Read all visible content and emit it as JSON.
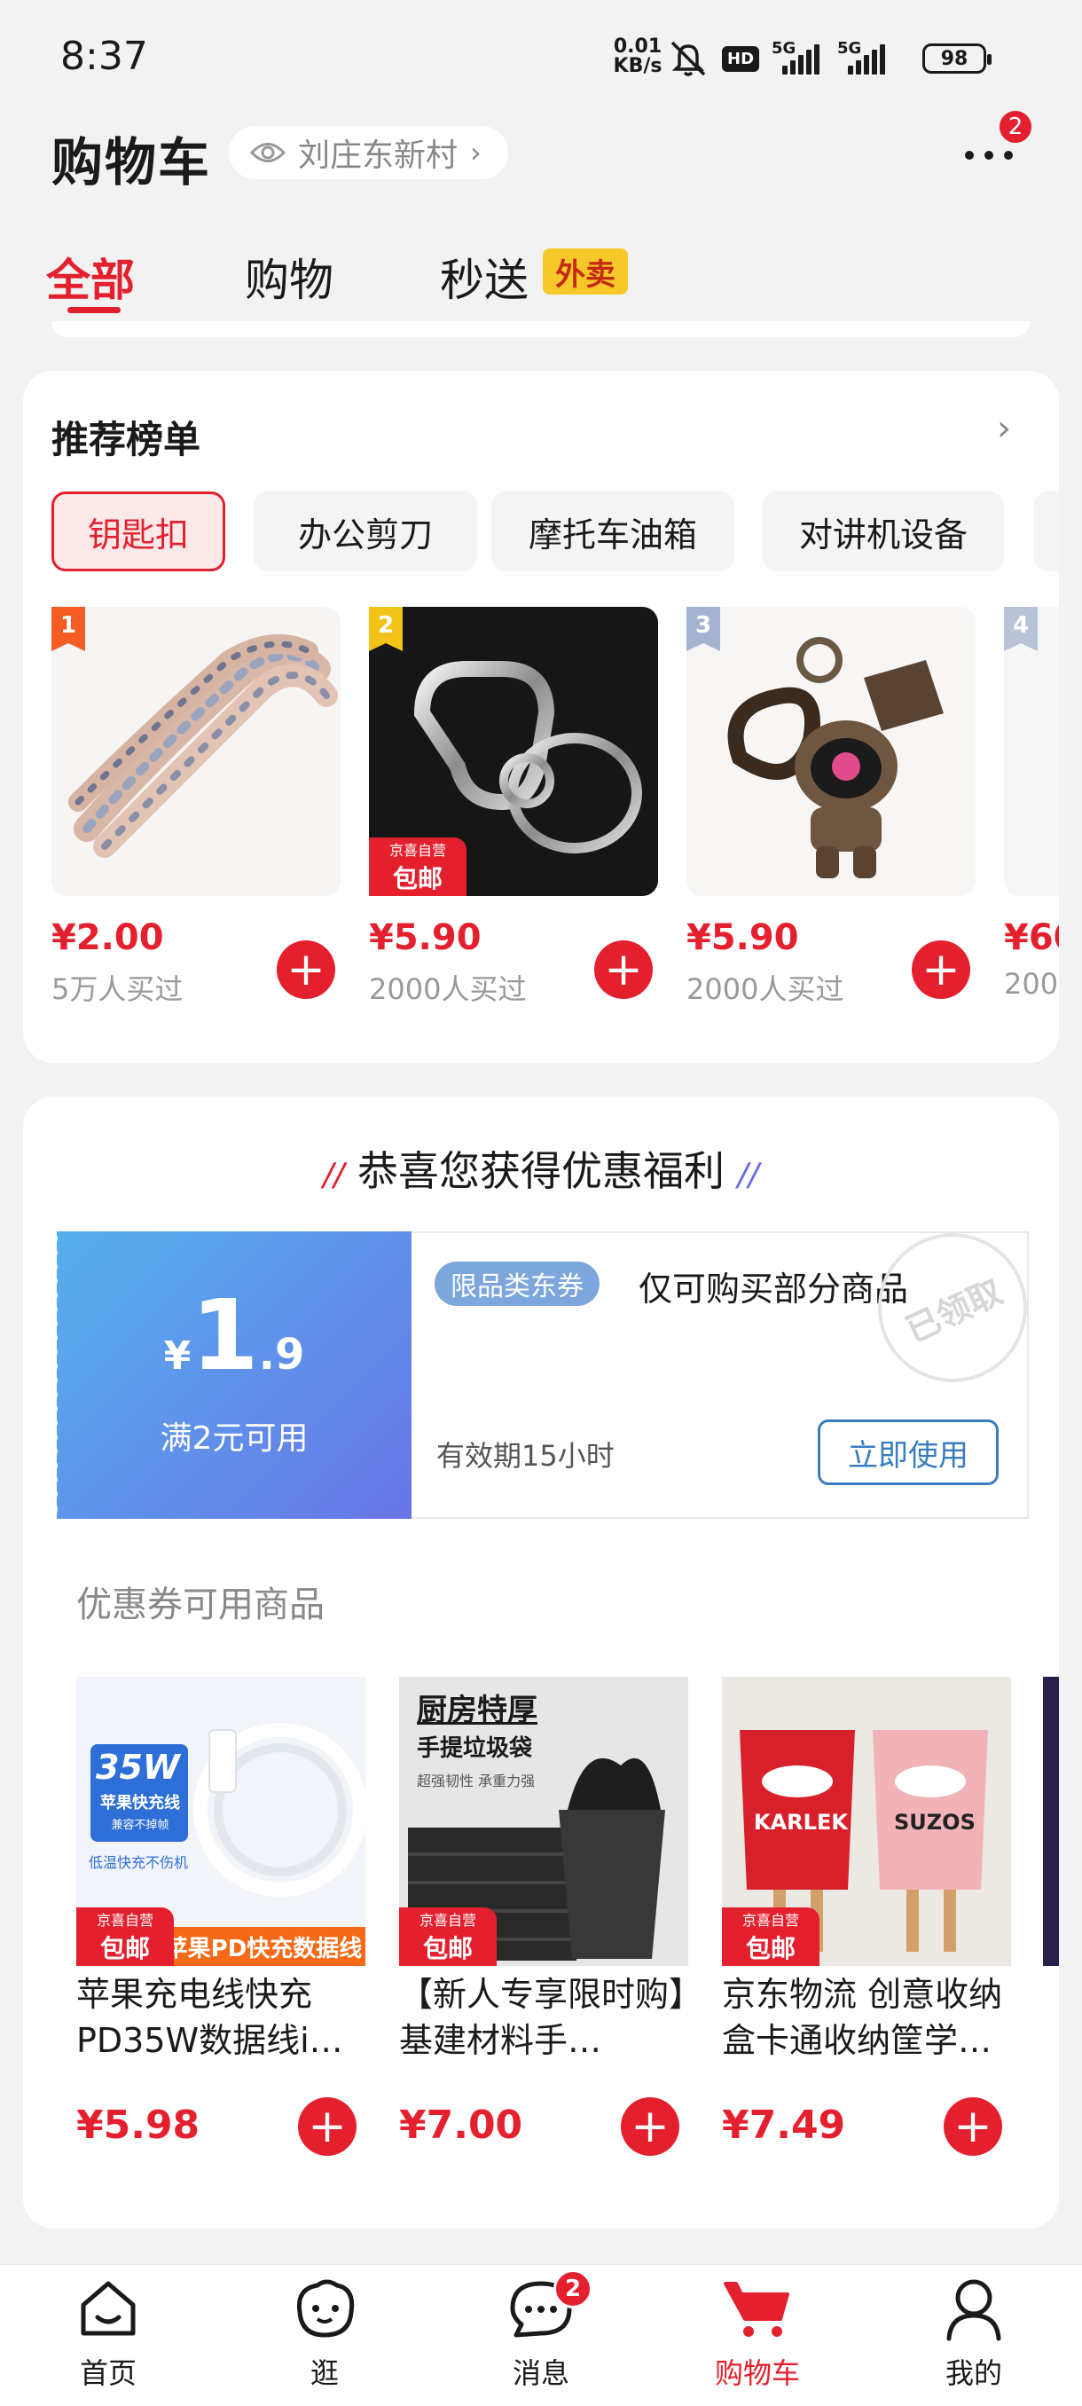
{
  "status_bar": {
    "time": "8:37",
    "speed_value": "0.01",
    "speed_unit": "KB/s",
    "hd": "HD",
    "net1": "5G",
    "net2": "5G",
    "battery": "98"
  },
  "header": {
    "title": "购物车",
    "location": "刘庄东新村",
    "more_badge": "2"
  },
  "tabs": [
    {
      "label": "全部",
      "active": true
    },
    {
      "label": "购物",
      "active": false
    },
    {
      "label": "秒送",
      "active": false,
      "tag": "外卖"
    }
  ],
  "recommend": {
    "title": "推荐榜单",
    "categories": [
      "钥匙扣",
      "办公剪刀",
      "摩托车油箱",
      "对讲机设备"
    ],
    "items": [
      {
        "rank": "1",
        "price": "¥2.00",
        "sold": "5万人买过",
        "self_badge": false
      },
      {
        "rank": "2",
        "price": "¥5.90",
        "sold": "2000人买过",
        "self_badge": true
      },
      {
        "rank": "3",
        "price": "¥5.90",
        "sold": "2000人买过",
        "self_badge": false
      },
      {
        "rank": "4",
        "price": "¥60",
        "sold": "200",
        "self_badge": false
      }
    ]
  },
  "self_badge": {
    "line1": "京喜自营",
    "line2": "包邮"
  },
  "coupon": {
    "heading": "恭喜您获得优惠福利",
    "currency": "¥",
    "amount_int": "1",
    "amount_dec": ".9",
    "condition": "满2元可用",
    "type_tag": "限品类东券",
    "desc": "仅可购买部分商品",
    "validity": "有效期15小时",
    "button": "立即使用",
    "stamp": "已领取"
  },
  "coupon_goods": {
    "title": "优惠券可用商品",
    "items": [
      {
        "name": "苹果充电线快充PD35W数据线i…",
        "price": "¥5.98",
        "img_tag": "苹果PD快充数据线",
        "img_text1": "35W",
        "img_text2": "苹果快充线",
        "img_text3": "兼容不掉帧",
        "img_text4": "低温快充不伤机"
      },
      {
        "name": "【新人专享限时购】基建材料手…",
        "price": "¥7.00",
        "img_text1": "厨房特厚",
        "img_text2": "手提垃圾袋",
        "img_text3": "超强韧性 承重力强"
      },
      {
        "name": "京东物流 创意收纳盒卡通收纳筐学…",
        "price": "¥7.49",
        "img_text1": "KARLEK",
        "img_text2": "SUZOS"
      }
    ]
  },
  "bottom_nav": [
    {
      "label": "首页",
      "icon": "home-icon",
      "active": false
    },
    {
      "label": "逛",
      "icon": "browse-face-icon",
      "active": false
    },
    {
      "label": "消息",
      "icon": "message-icon",
      "active": false,
      "badge": "2"
    },
    {
      "label": "购物车",
      "icon": "cart-icon",
      "active": true
    },
    {
      "label": "我的",
      "icon": "profile-icon",
      "active": false
    }
  ],
  "colors": {
    "accent": "#e4202e",
    "coupon_blue": "#3a7cc0",
    "tag_yellow": "#f6c82a"
  }
}
